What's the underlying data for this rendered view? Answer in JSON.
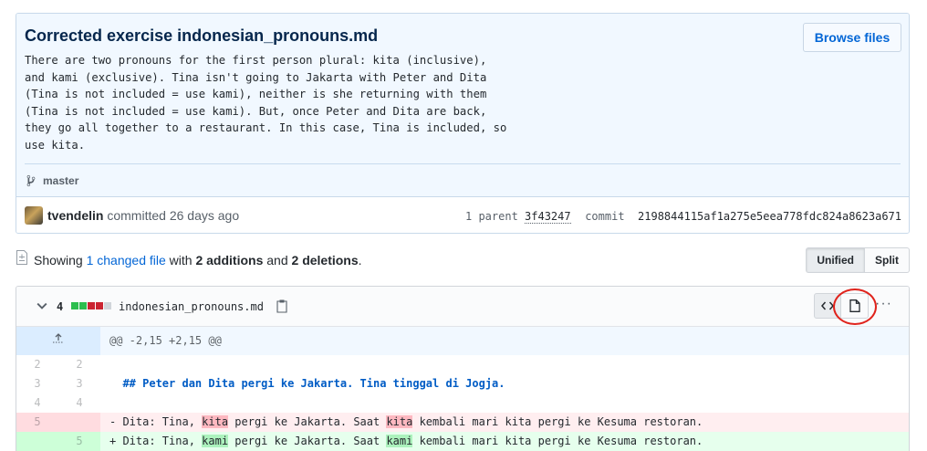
{
  "commit": {
    "title": "Corrected exercise indonesian_pronouns.md",
    "browse_label": "Browse files",
    "description": "There are two pronouns for the first person plural: kita (inclusive),\nand kami (exclusive). Tina isn't going to Jakarta with Peter and Dita\n(Tina is not included = use kami), neither is she returning with them\n(Tina is not included = use kami). But, once Peter and Dita are back,\nthey go all together to a restaurant. In this case, Tina is included, so\nuse kita.",
    "branch": "master",
    "author": "tvendelin",
    "committed_text": "committed 26 days ago",
    "parent_label": "1 parent",
    "parent_sha": "3f43247",
    "commit_label": "commit",
    "commit_sha": "2198844115af1a275e5eea778fdc824a8623a671"
  },
  "toolbar": {
    "showing": "Showing",
    "changed_files": "1 changed file",
    "with": "with",
    "additions": "2 additions",
    "and": "and",
    "deletions": "2 deletions",
    "period": ".",
    "unified_label": "Unified",
    "split_label": "Split",
    "active_view": "Unified"
  },
  "diff_file": {
    "change_count": "4",
    "filename": "indonesian_pronouns.md",
    "diffstat": [
      "add",
      "add",
      "del",
      "del",
      "neutral"
    ],
    "diffstat_colors": {
      "add": "#2cbe4e",
      "del": "#cb2431",
      "neutral": "#d1d5da"
    },
    "hunk_header": "@@ -2,15 +2,15 @@",
    "lines": [
      {
        "type": "ctx",
        "old": "2",
        "new": "2",
        "prefix": " ",
        "segments": [
          {
            "t": ""
          }
        ]
      },
      {
        "type": "ctx heading",
        "old": "3",
        "new": "3",
        "prefix": " ",
        "segments": [
          {
            "t": " ## Peter dan Dita pergi ke Jakarta. Tina tinggal di Jogja."
          }
        ]
      },
      {
        "type": "ctx",
        "old": "4",
        "new": "4",
        "prefix": " ",
        "segments": [
          {
            "t": ""
          }
        ]
      },
      {
        "type": "del",
        "old": "5",
        "new": "",
        "prefix": "-",
        "segments": [
          {
            "t": " Dita: Tina, "
          },
          {
            "t": "kita",
            "hl": true
          },
          {
            "t": " pergi ke Jakarta. Saat "
          },
          {
            "t": "kita",
            "hl": true
          },
          {
            "t": " kembali mari kita pergi ke Kesuma restoran."
          }
        ]
      },
      {
        "type": "add",
        "old": "",
        "new": "5",
        "prefix": "+",
        "segments": [
          {
            "t": " Dita: Tina, "
          },
          {
            "t": "kami",
            "hl": true
          },
          {
            "t": " pergi ke Jakarta. Saat "
          },
          {
            "t": "kami",
            "hl": true
          },
          {
            "t": " kembali mari kita pergi ke Kesuma restoran."
          }
        ]
      }
    ]
  }
}
